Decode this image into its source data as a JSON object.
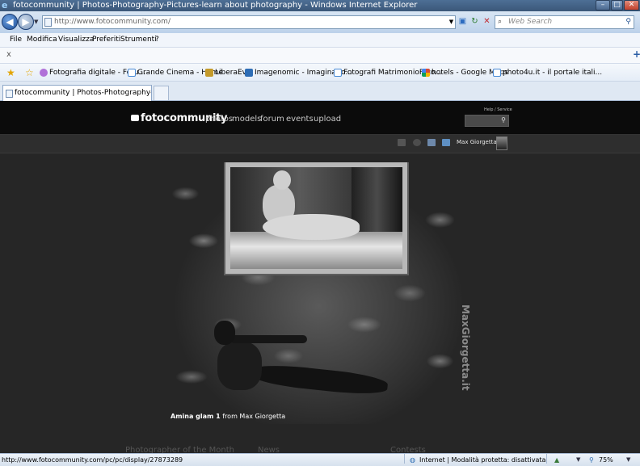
{
  "window": {
    "title": "fotocommunity | Photos-Photography-Pictures-learn about photography - Windows Internet Explorer",
    "controls": {
      "minimize": "–",
      "maximize": "□",
      "close": "✕"
    }
  },
  "addressbar": {
    "url": "http://www.fotocommunity.com/",
    "search_placeholder": "Web Search"
  },
  "menu": [
    "File",
    "Modifica",
    "Visualizza",
    "Preferiti",
    "Strumenti",
    "?"
  ],
  "toolbar": {
    "close_glyph": "x",
    "add_glyph": "+"
  },
  "favorites": [
    {
      "label": "Fotografia digitale - Foru...",
      "color": "#b070d8"
    },
    {
      "label": "Grande Cinema - Home",
      "color": "#4a8bd6"
    },
    {
      "label": "LiberaEva",
      "color": "#c49a2a"
    },
    {
      "label": "Imagenomic - Imaginatio...",
      "color": "#2e6db5"
    },
    {
      "label": "Fotografi MatrimonioFoto...",
      "color": "#4a8bd6"
    },
    {
      "label": "hotels - Google Maps",
      "color": "#d44b3a"
    },
    {
      "label": "photo4u.it - il portale itali...",
      "color": "#4a8bd6"
    }
  ],
  "tabs": [
    {
      "label": "fotocommunity | Photos-Photography-Pictures-l..."
    }
  ],
  "site": {
    "logo": "fotocommunity",
    "nav": [
      "photos",
      "models",
      "forum",
      "events",
      "upload"
    ],
    "help_link": "Help / Service",
    "user": "Max Giorgetta",
    "photo": {
      "title": "Amina glam 1",
      "from_label": "from",
      "author": "Max Giorgetta",
      "watermark": "MaxGiorgetta.it"
    },
    "sections": [
      "Photographer of the Month",
      "News",
      "Contests"
    ]
  },
  "status": {
    "url": "http://www.fotocommunity.com/pc/pc/display/27873289",
    "zone": "Internet | Modalità protetta: disattivata",
    "zoom": "75%"
  }
}
